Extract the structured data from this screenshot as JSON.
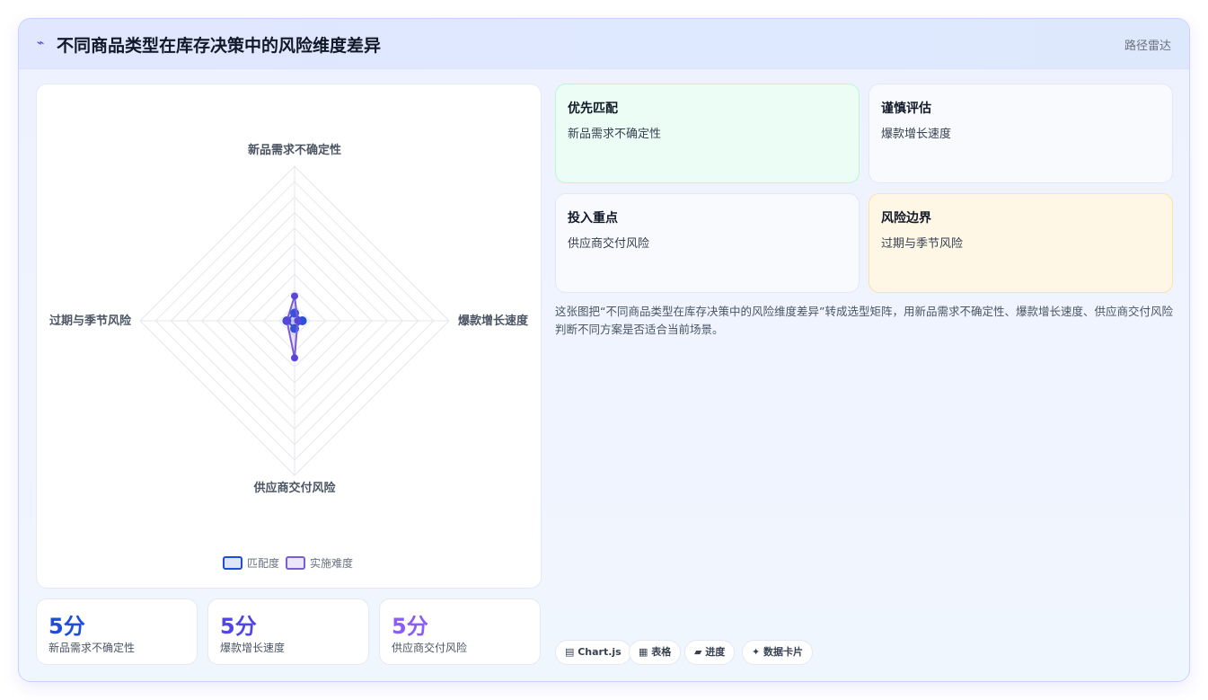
{
  "header": {
    "icon": "trend-icon",
    "title": "不同商品类型在库存决策中的风险维度差异",
    "badge": "路径雷达"
  },
  "chart_data": {
    "type": "radar",
    "axes": [
      "新品需求不确定性",
      "爆款增长速度",
      "供应商交付风险",
      "过期与季节风险"
    ],
    "range": [
      0,
      100
    ],
    "levels": 10,
    "series": [
      {
        "name": "匹配度",
        "values": [
          5,
          5,
          5,
          5
        ],
        "color": "#1d4ed8"
      },
      {
        "name": "实施难度",
        "values": [
          16,
          2,
          24,
          5
        ],
        "color": "#7c5cd6"
      }
    ],
    "legend_position": "bottom"
  },
  "stats": [
    {
      "value": "5分",
      "label": "新品需求不确定性",
      "color": "#1d4ed8"
    },
    {
      "value": "5分",
      "label": "爆款增长速度",
      "color": "#4f46e5"
    },
    {
      "value": "5分",
      "label": "供应商交付风险",
      "color": "#8b5cf6"
    }
  ],
  "tiles": [
    {
      "title": "优先匹配",
      "subtitle": "新品需求不确定性"
    },
    {
      "title": "谨慎评估",
      "subtitle": "爆款增长速度"
    },
    {
      "title": "投入重点",
      "subtitle": "供应商交付风险"
    },
    {
      "title": "风险边界",
      "subtitle": "过期与季节风险"
    }
  ],
  "description": "这张图把“不同商品类型在库存决策中的风险维度差异”转成选型矩阵，用新品需求不确定性、爆款增长速度、供应商交付风险判断不同方案是否适合当前场景。",
  "tags": [
    {
      "icon": "chart-icon",
      "label": "▤ Chart.js"
    },
    {
      "icon": "table-icon",
      "label": "▦ 表格"
    },
    {
      "icon": "progress-icon",
      "label": "▰ 进度"
    },
    {
      "icon": "card-icon",
      "label": "✦ 数据卡片"
    }
  ]
}
